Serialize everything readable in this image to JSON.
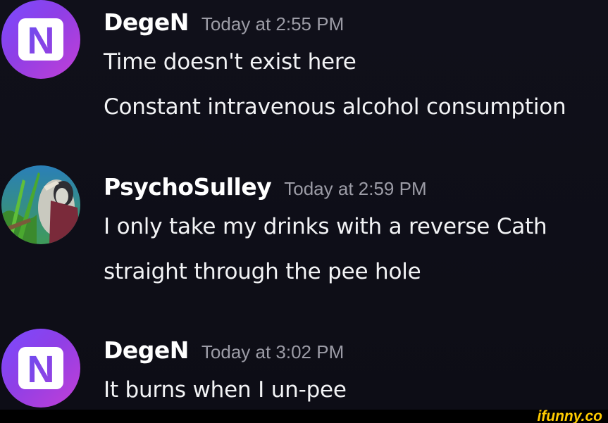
{
  "messages": [
    {
      "username": "DegeN",
      "timestamp": "Today at 2:55 PM",
      "avatar": "n-logo-avatar",
      "lines": [
        "Time doesn't exist here",
        "Constant intravenous alcohol consumption"
      ]
    },
    {
      "username": "PsychoSulley",
      "timestamp": "Today at 2:59 PM",
      "avatar": "character-avatar",
      "lines": [
        "I only take my drinks with a reverse Cath",
        "straight through the pee hole"
      ]
    },
    {
      "username": "DegeN",
      "timestamp": "Today at 3:02 PM",
      "avatar": "n-logo-avatar",
      "lines": [
        "It burns when I un-pee"
      ]
    }
  ],
  "avatar_logo_letter": "N",
  "watermark": "ifunny.co",
  "colors": {
    "background": "#0e0e17",
    "username": "#ffffff",
    "timestamp": "#9c9ca6",
    "message_text": "#f2f3f5",
    "avatar_gradient_start": "#7a4bff",
    "avatar_gradient_end": "#c23fd6",
    "watermark": "#ffcc00"
  }
}
